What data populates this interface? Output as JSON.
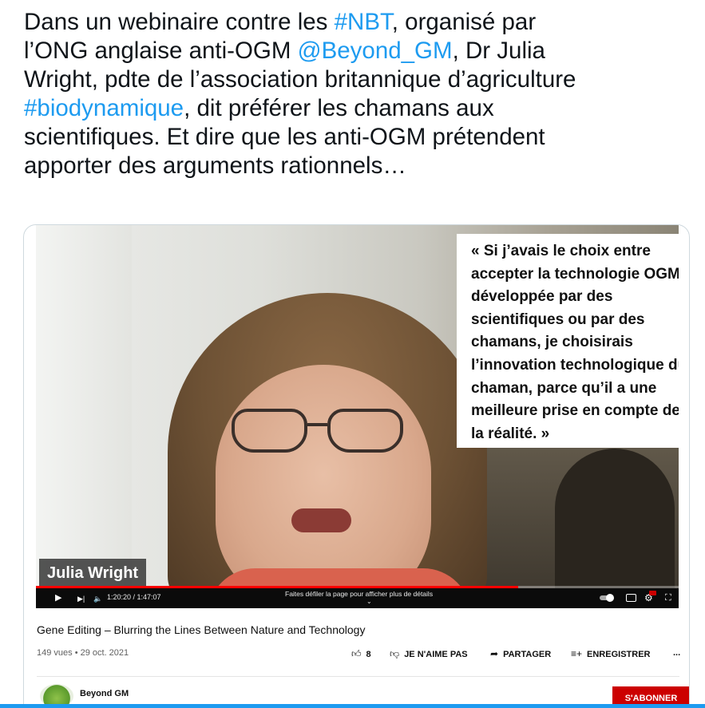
{
  "tweet": {
    "lines": [
      {
        "pre": "Dans un webinaire contre les ",
        "link": "#NBT",
        "post": ", organisé par"
      },
      {
        "pre": "l’ONG anglaise anti-OGM ",
        "link": "@Beyond_GM",
        "post": ", Dr Julia"
      },
      {
        "pre": "Wright, pdte de l’association britannique d’agriculture",
        "link": "",
        "post": ""
      },
      {
        "pre": "",
        "link": "#biodynamique",
        "post": ", dit préférer les chamans aux"
      },
      {
        "pre": "scientifiques. Et dire que les anti-OGM prétendent",
        "link": "",
        "post": ""
      },
      {
        "pre": "apporter des arguments rationnels…",
        "link": "",
        "post": ""
      }
    ]
  },
  "video": {
    "quote_lines": [
      "« Si j’avais le choix entre",
      "accepter la technologie OGM",
      "développée par des",
      "scientifiques ou par des",
      "chamans, je choisirais",
      "l’innovation technologique du",
      "chaman, parce qu’il a une",
      "meilleure prise en compte de",
      "la réalité. »"
    ],
    "speaker_name": "Julia Wright",
    "time": "1:20:20 / 1:47:07",
    "scroll_hint": "Faites défiler la page pour afficher plus de détails",
    "progress_fraction": 0.75,
    "progress_color": "#ff0000",
    "icons": {
      "play": "▶",
      "next": "▶|",
      "volume": "🔈",
      "autoplay": "toggle-icon",
      "subtitles": "subtitles-icon",
      "settings": "gear-icon",
      "fullscreen": "fullscreen-icon"
    }
  },
  "youtube": {
    "title": "Gene Editing – Blurring the Lines Between Nature and Technology",
    "views_date": "149 vues • 29 oct. 2021",
    "likes": "8",
    "dislike_label": "JE N'AIME PAS",
    "share_label": "PARTAGER",
    "save_label": "ENREGISTRER",
    "more_label": "...",
    "channel_name": "Beyond GM",
    "subscribe_label": "S'ABONNER",
    "subscribe_color": "#cc0000"
  },
  "colors": {
    "link": "#1d9bf0",
    "text": "#0f1419"
  }
}
